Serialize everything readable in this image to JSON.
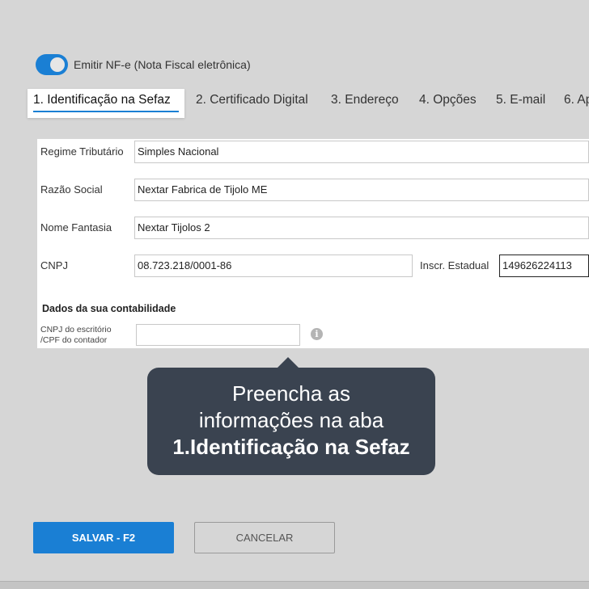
{
  "toggle": {
    "label": "Emitir NF-e (Nota Fiscal eletrônica)",
    "on": true
  },
  "tabs": [
    {
      "label": "1. Identificação na Sefaz",
      "active": true
    },
    {
      "label": "2. Certificado Digital"
    },
    {
      "label": "3. Endereço"
    },
    {
      "label": "4. Opções"
    },
    {
      "label": "5. E-mail"
    },
    {
      "label": "6. Ap"
    }
  ],
  "form": {
    "regime": {
      "label": "Regime Tributário",
      "value": "Simples Nacional"
    },
    "razao": {
      "label": "Razão Social",
      "value": "Nextar Fabrica de Tijolo ME"
    },
    "fantasia": {
      "label": "Nome Fantasia",
      "value": "Nextar Tijolos 2"
    },
    "cnpj": {
      "label": "CNPJ",
      "value": "08.723.218/0001-86"
    },
    "inscr": {
      "label": "Inscr. Estadual",
      "value": "149626224113"
    },
    "contabilidade_title": "Dados da sua contabilidade",
    "contador": {
      "label_line1": "CNPJ do escritório",
      "label_line2": "/CPF do contador",
      "value": ""
    },
    "info_icon": "i"
  },
  "tooltip": {
    "line1": "Preencha as",
    "line2": "informações na aba",
    "line3": "1.Identificação na Sefaz"
  },
  "buttons": {
    "save": "SALVAR - F2",
    "cancel": "CANCELAR"
  },
  "colors": {
    "accent": "#1a7fd4",
    "tooltip_bg": "#3a4350",
    "page_bg": "#d6d6d6"
  }
}
